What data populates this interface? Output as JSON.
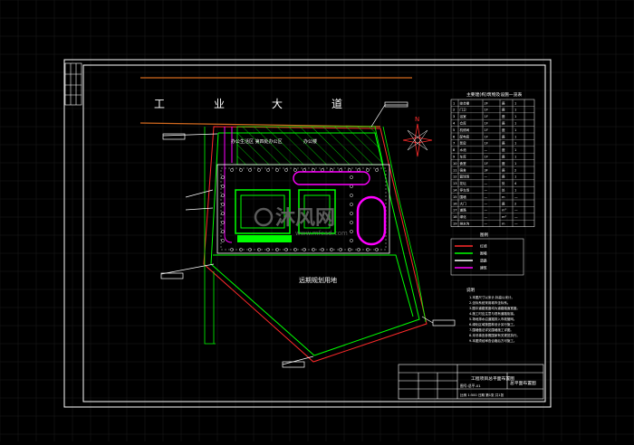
{
  "drawing": {
    "road_name": [
      "工",
      "业",
      "大",
      "道"
    ],
    "plant_label": "办公生活区\n第四处办公区",
    "office_label": "办公楼",
    "future_label": "远期规划用地",
    "north_label": "N",
    "watermark_main": "沐风网",
    "watermark_url": "www.mfcad.com",
    "colors": {
      "background": "#000000",
      "frame": "#ffffff",
      "grid": "#1c1c1c",
      "road": "#d2691e",
      "boundary_green": "#00ff00",
      "boundary_red": "#ff2a2a",
      "magenta": "#ff00ff",
      "hatch": "#00ff00",
      "wall": "#ffffff",
      "watermark": "#6a6a6a"
    }
  },
  "table": {
    "title": "主要建(构)筑物及设施一览表",
    "rows": [
      [
        "1",
        "综合楼",
        "2F",
        "座",
        "1"
      ],
      [
        "2",
        "门卫",
        "1F",
        "座",
        "1"
      ],
      [
        "3",
        "浴室",
        "1F",
        "座",
        "1"
      ],
      [
        "4",
        "仓库",
        "1F",
        "座",
        "1"
      ],
      [
        "5",
        "机修间",
        "1F",
        "座",
        "1"
      ],
      [
        "6",
        "配电房",
        "1F",
        "座",
        "1"
      ],
      [
        "7",
        "泵房",
        "1F",
        "座",
        "1"
      ],
      [
        "8",
        "水池",
        "—",
        "座",
        "1"
      ],
      [
        "9",
        "车库",
        "1F",
        "座",
        "1"
      ],
      [
        "10",
        "食堂",
        "1F",
        "座",
        "1"
      ],
      [
        "11",
        "宿舍",
        "3F",
        "座",
        "2"
      ],
      [
        "12",
        "篮球场",
        "—",
        "座",
        "1"
      ],
      [
        "13",
        "花坛",
        "—",
        "处",
        "4"
      ],
      [
        "14",
        "停车场",
        "—",
        "处",
        "1"
      ],
      [
        "15",
        "围墙",
        "—",
        "m",
        "—"
      ],
      [
        "16",
        "大门",
        "—",
        "座",
        "2"
      ],
      [
        "17",
        "道路",
        "—",
        "m²",
        "—"
      ],
      [
        "18",
        "绿化",
        "—",
        "m²",
        "—"
      ],
      [
        "19",
        "排水沟",
        "—",
        "m",
        "—"
      ]
    ]
  },
  "legend": {
    "title": "图例",
    "items": [
      {
        "color": "#ff2a2a",
        "label": "红线"
      },
      {
        "color": "#00ff00",
        "label": "围墙"
      },
      {
        "color": "#ffffff",
        "label": "道路"
      },
      {
        "color": "#ff00ff",
        "label": "建筑"
      }
    ]
  },
  "notes": {
    "title": "说明",
    "lines": [
      "1.本图尺寸以米计,标高以米计。",
      "2.坐标系统采用城市坐标系。",
      "3.图中道路宽度均为道路路面宽度。",
      "4.施工时应注意与现有道路衔接。",
      "5.场地排水沿道路排入市政管网。",
      "6.绿化区域按园林设计另行施工。",
      "7.围墙做法详见围墙施工详图。",
      "8.未尽事宜参照国家有关规范执行。",
      "9.本图须经审查合格后方可施工。"
    ]
  },
  "title_block": {
    "project": "工程项目总平面布置图",
    "drawing": "总平面布置图",
    "sub": "图号:总平-01",
    "footer": "比例 1:500   日期   第1张 共1张"
  }
}
